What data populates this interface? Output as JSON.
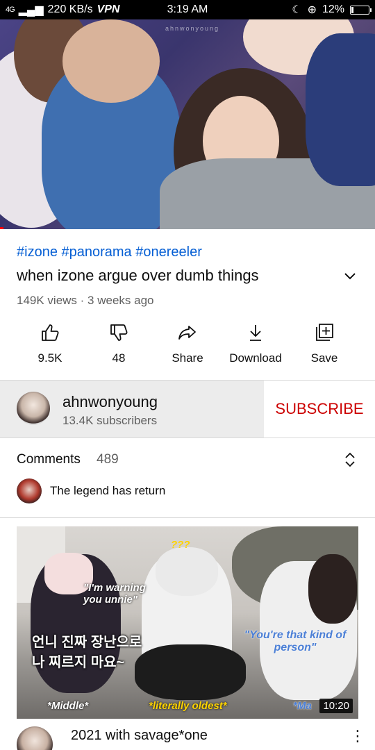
{
  "status_bar": {
    "network": "4G",
    "speed": "220 KB/s",
    "vpn": "VPN",
    "time": "3:19 AM",
    "battery": "12%",
    "battery_level": 0.12
  },
  "player": {
    "watermark": "ahnwonyoung",
    "progress": 0.01
  },
  "video": {
    "hashtags": "#izone #panorama #onereeler",
    "title": "when izone argue over dumb things",
    "meta": "149K views · 3 weeks ago"
  },
  "actions": {
    "like": "9.5K",
    "dislike": "48",
    "share": "Share",
    "download": "Download",
    "save": "Save"
  },
  "channel": {
    "name": "ahnwonyoung",
    "subscribers": "13.4K subscribers",
    "subscribe_label": "SUBSCRIBE"
  },
  "comments": {
    "label": "Comments",
    "count": "489",
    "top_comment": "The legend has return"
  },
  "next_video": {
    "thumbnail_captions": {
      "question": "???",
      "warning": "\"I'm warning you unnie\"",
      "korean": "언니 진짜 장난으로 나 찌르지 마요~",
      "person": "\"You're that kind of person\"",
      "middle": "*Middle*",
      "oldest": "*literally oldest*",
      "ma": "*Ma"
    },
    "duration": "10:20",
    "title": "2021 with savage*one"
  },
  "colors": {
    "link": "#065fd4",
    "subscribe": "#cc0000",
    "progress": "#ff0000",
    "secondary_text": "#606060"
  }
}
